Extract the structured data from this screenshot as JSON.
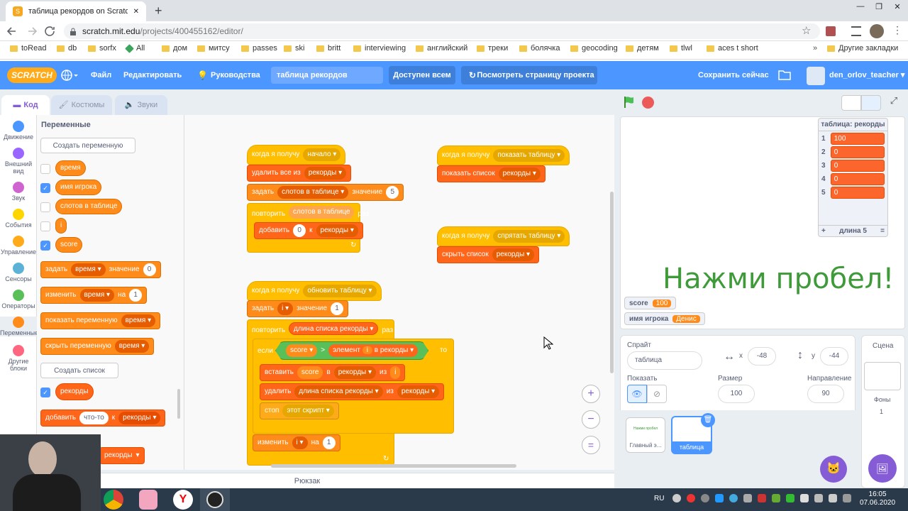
{
  "browser": {
    "tab_title": "таблица рекордов on Scratch",
    "tab_close": "✕",
    "new_tab": "+",
    "url_domain": "scratch.mit.edu",
    "url_path": "/projects/400455162/editor/",
    "window_controls": [
      "—",
      "❐",
      "✕"
    ]
  },
  "bookmarks": [
    "toRead",
    "db",
    "sorfx",
    "All",
    "дом",
    "митсу",
    "passes",
    "ski",
    "britt",
    "interviewing",
    "английский",
    "треки",
    "болячка",
    "geocoding",
    "детям",
    "tlwl",
    "aces t short"
  ],
  "bookmarks_more": "»",
  "bookmarks_other": "Другие закладки",
  "menu": {
    "logo": "SCRATCH",
    "file": "Файл",
    "edit": "Редактировать",
    "tutorials": "Руководства",
    "project_title": "таблица рекордов",
    "share": "Доступен всем",
    "see_project": "Посмотреть страницу проекта",
    "save": "Сохранить сейчас",
    "user": "den_orlov_teacher"
  },
  "editor_tabs": {
    "code": "Код",
    "costumes": "Костюмы",
    "sounds": "Звуки"
  },
  "categories": [
    {
      "label": "Движение",
      "color": "#4c97ff"
    },
    {
      "label": "Внешний вид",
      "color": "#9966ff"
    },
    {
      "label": "Звук",
      "color": "#cf63cf"
    },
    {
      "label": "События",
      "color": "#ffd500"
    },
    {
      "label": "Управление",
      "color": "#ffab19"
    },
    {
      "label": "Сенсоры",
      "color": "#5cb1d6"
    },
    {
      "label": "Операторы",
      "color": "#59c059"
    },
    {
      "label": "Переменные",
      "color": "#ff8c1a"
    },
    {
      "label": "Другие блоки",
      "color": "#ff6680"
    }
  ],
  "palette": {
    "heading": "Переменные",
    "make_var": "Создать переменную",
    "vars": [
      {
        "name": "время",
        "checked": false
      },
      {
        "name": "имя игрока",
        "checked": true
      },
      {
        "name": "слотов в таблице",
        "checked": false
      },
      {
        "name": "i",
        "checked": false
      },
      {
        "name": "score",
        "checked": true
      }
    ],
    "set": "задать",
    "set_var": "время",
    "set_to": "значение",
    "set_val": "0",
    "change": "изменить",
    "change_var": "время",
    "change_by": "на",
    "change_val": "1",
    "show_var": "показать переменную",
    "show_var_v": "время",
    "hide_var": "скрыть переменную",
    "hide_var_v": "время",
    "make_list": "Создать список",
    "list_name": "рекорды",
    "add": "добавить",
    "add_item": "что-то",
    "add_to": "к",
    "add_list": "рекорды",
    "partial_list": "рекорды"
  },
  "scripts": {
    "s1": {
      "hat": "когда я получу",
      "msg": "начало",
      "del": "удалить все из",
      "del_list": "рекорды",
      "set": "задать",
      "set_var": "слотов в таблице",
      "set_to": "значение",
      "set_val": "5",
      "repeat": "повторить",
      "rep_var": "слотов в таблице",
      "times": "раз",
      "add": "добавить",
      "add_val": "0",
      "to": "к",
      "add_list": "рекорды",
      "arrow": "↻"
    },
    "s2": {
      "hat": "когда я получу",
      "msg": "показать таблицу",
      "show": "показать список",
      "list": "рекорды"
    },
    "s3": {
      "hat": "когда я получу",
      "msg": "спрятать таблицу",
      "hide": "скрыть список",
      "list": "рекорды"
    },
    "s4": {
      "hat": "когда я получу",
      "msg": "обновить таблицу",
      "set": "задать",
      "set_var": "i",
      "set_to": "значение",
      "set_val": "1",
      "repeat": "повторить",
      "len": "длина списка",
      "len_list": "рекорды",
      "times": "раз",
      "if": "если",
      "score": "score",
      "gt": ">",
      "item": "элемент",
      "item_i": "i",
      "in": "в",
      "item_list": "рекорды",
      "then": "то",
      "insert": "вставить",
      "ins_v": "score",
      "ins_in": "в",
      "ins_list": "рекорды",
      "ins_at": "из",
      "ins_i": "i",
      "delete": "удалить",
      "del_len": "длина списка",
      "del_len_list": "рекорды",
      "del_from": "из",
      "del_list": "рекорды",
      "stop": "стоп",
      "stop_opt": "этот скрипт",
      "change": "изменить",
      "ch_var": "i",
      "ch_by": "на",
      "ch_val": "1",
      "arrow": "↻"
    }
  },
  "backpack": "Рюкзак",
  "zoom": {
    "in": "+",
    "out": "−",
    "reset": "="
  },
  "stage": {
    "list_title": "таблица: рекорды",
    "items": [
      {
        "idx": "1",
        "val": "100"
      },
      {
        "idx": "2",
        "val": "0"
      },
      {
        "idx": "3",
        "val": "0"
      },
      {
        "idx": "4",
        "val": "0"
      },
      {
        "idx": "5",
        "val": "0"
      }
    ],
    "plus": "+",
    "length": "длина 5",
    "eq": "=",
    "text": "Нажми пробел!",
    "mon_score": "score",
    "mon_score_v": "100",
    "mon_player": "имя игрока",
    "mon_player_v": "Денис"
  },
  "sprite": {
    "label": "Спрайт",
    "name": "таблица",
    "x_label": "x",
    "x": "-48",
    "y_label": "y",
    "y": "-44",
    "show": "Показать",
    "size_label": "Размер",
    "size": "100",
    "dir_label": "Направление",
    "dir": "90",
    "thumbs": [
      {
        "name": "Главный э...",
        "preview": "Нажми пробел"
      },
      {
        "name": "таблица"
      }
    ]
  },
  "scene": {
    "label": "Сцена",
    "backdrops": "Фоны",
    "count": "1"
  },
  "taskbar": {
    "lang": "RU",
    "time": "16:05",
    "date": "07.06.2020"
  }
}
